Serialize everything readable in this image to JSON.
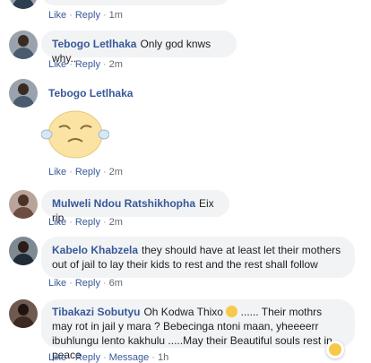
{
  "comments": [
    {
      "actions": {
        "like": "Like",
        "reply": "Reply",
        "time": "1m"
      }
    },
    {
      "author": "Tebogo Letlhaka",
      "text": "Only god knws why..",
      "actions": {
        "like": "Like",
        "reply": "Reply",
        "time": "2m"
      }
    },
    {
      "author": "Tebogo Letlhaka",
      "sticker": "crying-blob-sticker",
      "actions": {
        "like": "Like",
        "reply": "Reply",
        "time": "2m"
      }
    },
    {
      "author": "Mulweli Ndou Ratshikhopha",
      "text": "Eix rip",
      "actions": {
        "like": "Like",
        "reply": "Reply",
        "time": "2m"
      }
    },
    {
      "author": "Kabelo Khabzela",
      "text": "they should have at least let their mothers out of jail to lay their kids to rest and the rest shall follow",
      "actions": {
        "like": "Like",
        "reply": "Reply",
        "time": "6m"
      }
    },
    {
      "author": "Tibakazi Sobutyu",
      "text_before_emoji": "Oh Kodwa Thixo",
      "text_after_emoji": "...... Their mothrs may rot in jail y mara ? Bebecinga ntoni maan, yheeeerr ibuhlungu lento kakhulu .....May their Beautiful souls rest in peace",
      "reaction": "sad-reaction-icon",
      "actions": {
        "like": "Like",
        "reply": "Reply",
        "message": "Message",
        "time": "1h"
      }
    }
  ],
  "colors": {
    "name": "#385898",
    "bubble": "#f2f3f5",
    "meta": "#606770"
  }
}
